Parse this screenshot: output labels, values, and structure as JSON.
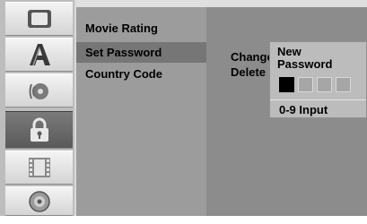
{
  "icons": [
    {
      "name": "tv-screen-icon"
    },
    {
      "name": "language-icon"
    },
    {
      "name": "audio-disc-icon"
    },
    {
      "name": "lock-icon"
    },
    {
      "name": "film-icon"
    },
    {
      "name": "disc-icon"
    }
  ],
  "menu": {
    "items": [
      {
        "label": "Movie Rating"
      },
      {
        "label": "Set Password"
      },
      {
        "label": "Country Code"
      }
    ]
  },
  "submenu": {
    "options": [
      {
        "label": "Change"
      },
      {
        "label": "Delete"
      }
    ]
  },
  "popup": {
    "title": "New\nPassword",
    "digits_entered": 1,
    "digits_total": 4,
    "hint": "0-9 Input"
  },
  "colors": {
    "icon_column": "#bdbdbd",
    "menu_panel": "#9c9c9c",
    "selected_item": "#767676",
    "right_panel": "#8c8c8c",
    "popup": "#bcbcbc"
  }
}
